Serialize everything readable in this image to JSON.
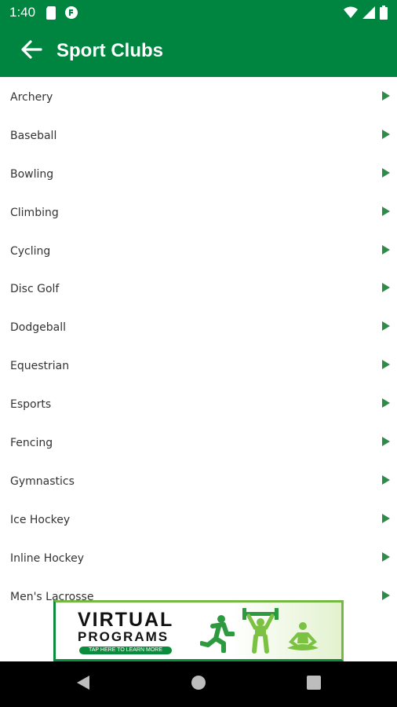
{
  "status": {
    "time": "1:40"
  },
  "app_bar": {
    "title": "Sport Clubs"
  },
  "list": {
    "items": [
      "Archery",
      "Baseball",
      "Bowling",
      "Climbing",
      "Cycling",
      "Disc Golf",
      "Dodgeball",
      "Equestrian",
      "Esports",
      "Fencing",
      "Gymnastics",
      "Ice Hockey",
      "Inline Hockey",
      "Men's Lacrosse"
    ]
  },
  "ad": {
    "line1": "VIRTUAL",
    "line2": "PROGRAMS",
    "cta": "TAP HERE TO LEARN MORE"
  },
  "icons": {
    "status_left": [
      "sd-card-icon",
      "notification-icon"
    ],
    "status_right": [
      "wifi-icon",
      "signal-icon",
      "battery-icon"
    ],
    "back": "back-arrow-icon",
    "list_arrow": "chevron-right-icon",
    "nav": [
      "nav-back-icon",
      "nav-home-icon",
      "nav-recents-icon"
    ]
  },
  "colors": {
    "primary": "#008540",
    "arrow": "#2e8b4a",
    "ad_green": "#0a8c3c",
    "ad_light_green": "#75b843"
  }
}
